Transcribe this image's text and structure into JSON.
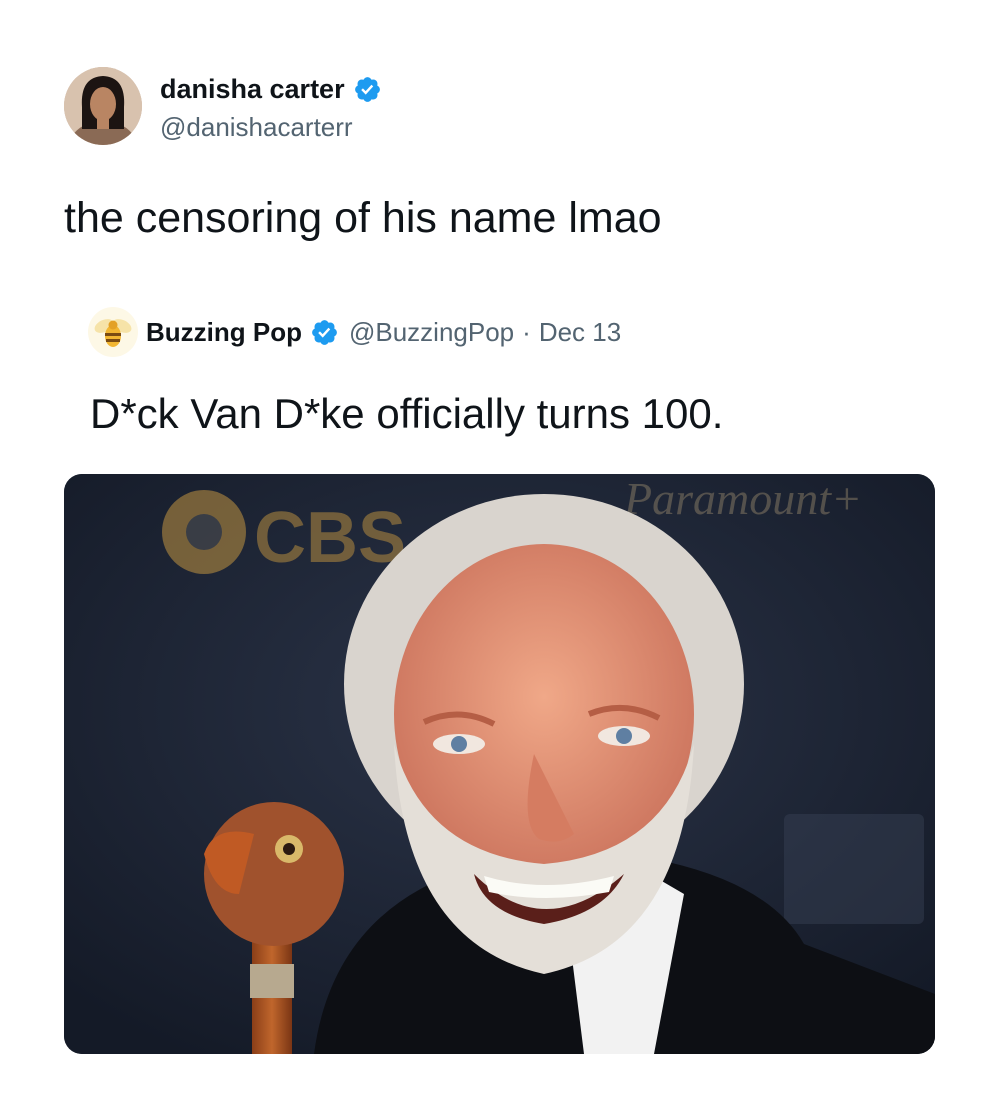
{
  "author": {
    "display_name": "danisha carter",
    "handle": "@danishacarterr",
    "verified": true,
    "avatar_icon": "profile-photo"
  },
  "tweet": {
    "text": "the censoring of his name lmao"
  },
  "quoted": {
    "display_name": "Buzzing Pop",
    "handle": "@BuzzingPop",
    "separator": "·",
    "date": "Dec 13",
    "verified": true,
    "avatar_icon": "bee-icon",
    "text": "D*ck Van D*ke officially turns 100.",
    "media": {
      "kind": "photo",
      "backdrop_logo_text": "CBS",
      "backdrop_logo_text_2": "Paramount+"
    }
  },
  "colors": {
    "verified_blue": "#1d9bf0",
    "text_primary": "#0f1419",
    "text_secondary": "#536471"
  }
}
